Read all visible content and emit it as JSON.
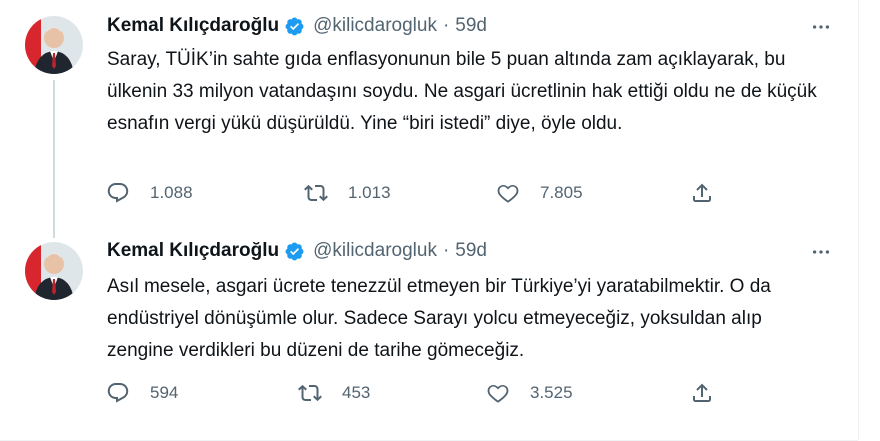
{
  "tweets": [
    {
      "author": "Kemal Kılıçdaroğlu",
      "handle": "@kilicdarogluk",
      "separator": "·",
      "time": "59d",
      "text": "Saray, TÜİK’in sahte gıda enflasyonunun bile 5 puan altında zam açıklayarak, bu ülkenin 33 milyon vatandaşını soydu. Ne asgari ücretlinin hak ettiği oldu ne de küçük esnafın vergi yükü düşürüldü. Yine “biri istedi” diye, öyle oldu.",
      "replies": "1.088",
      "retweets": "1.013",
      "likes": "7.805"
    },
    {
      "author": "Kemal Kılıçdaroğlu",
      "handle": "@kilicdarogluk",
      "separator": "·",
      "time": "59d",
      "text": "Asıl mesele, asgari ücrete tenezzül etmeyen bir Türkiye’yi yaratabilmektir. O da endüstriyel dönüşümle olur. Sadece Sarayı yolcu etmeyeceğiz, yoksuldan alıp zengine verdikleri bu düzeni de tarihe gömeceğiz.",
      "replies": "594",
      "retweets": "453",
      "likes": "3.525"
    }
  ],
  "colors": {
    "verified": "#1d9bf0",
    "muted": "#536471",
    "text": "#0f1419",
    "thread_line": "#cfd9de"
  },
  "icons": [
    "verified-badge-icon",
    "more-icon",
    "reply-icon",
    "retweet-icon",
    "like-icon",
    "share-icon"
  ]
}
